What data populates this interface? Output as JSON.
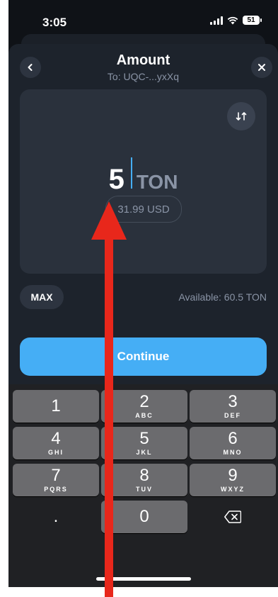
{
  "status": {
    "time": "3:05",
    "battery": "51"
  },
  "header": {
    "title": "Amount",
    "subtitle": "To: UQC-...yxXq"
  },
  "amount": {
    "value": "5",
    "currency": "TON",
    "fiat": "31.99 USD"
  },
  "balance": {
    "max_label": "MAX",
    "available": "Available: 60.5 TON"
  },
  "actions": {
    "continue_label": "Continue"
  },
  "keypad": {
    "keys": [
      {
        "num": "1",
        "letters": ""
      },
      {
        "num": "2",
        "letters": "ABC"
      },
      {
        "num": "3",
        "letters": "DEF"
      },
      {
        "num": "4",
        "letters": "GHI"
      },
      {
        "num": "5",
        "letters": "JKL"
      },
      {
        "num": "6",
        "letters": "MNO"
      },
      {
        "num": "7",
        "letters": "PQRS"
      },
      {
        "num": "8",
        "letters": "TUV"
      },
      {
        "num": "9",
        "letters": "WXYZ"
      },
      {
        "num": ".",
        "letters": ""
      },
      {
        "num": "0",
        "letters": ""
      }
    ]
  },
  "colors": {
    "accent": "#45aef5",
    "arrow": "#e8271b",
    "background": "#1d232c"
  },
  "icons": [
    "chevron-left-icon",
    "close-icon",
    "swap-icon",
    "backspace-icon",
    "signal-icon",
    "wifi-icon",
    "battery-icon"
  ]
}
